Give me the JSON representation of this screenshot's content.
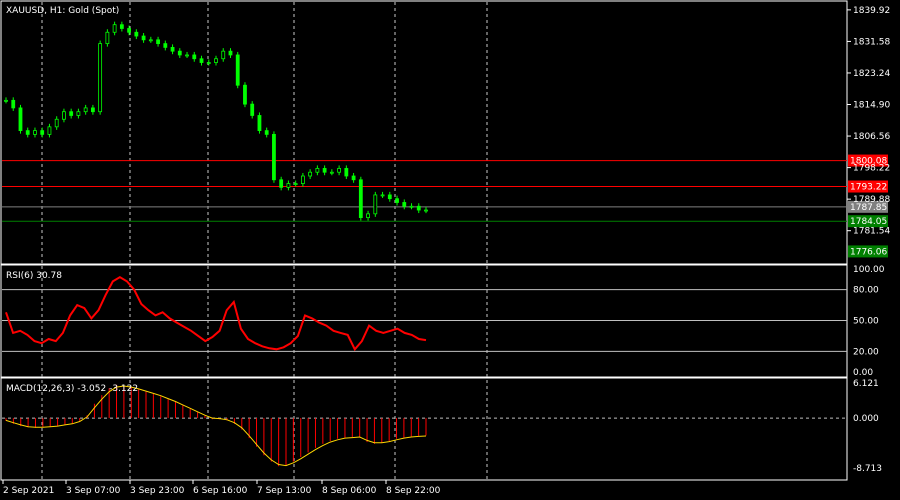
{
  "chart_title": "XAUUSD, H1:  Gold (Spot)",
  "rsi_title": "RSI(6) 30.78",
  "macd_title": "MACD(12,26,3) -3.052 -3.122",
  "price_axis": [
    "1839.92",
    "1831.58",
    "1823.24",
    "1814.90",
    "1806.56",
    "1798.22",
    "1789.88",
    "1781.54"
  ],
  "price_tags": [
    {
      "text": "1800.08",
      "kind": "red"
    },
    {
      "text": "1793.22",
      "kind": "red"
    },
    {
      "text": "1787.85",
      "kind": "grey"
    },
    {
      "text": "1784.05",
      "kind": "green"
    },
    {
      "text": "1776.06",
      "kind": "green"
    }
  ],
  "rsi_axis": [
    "100.00",
    "80.00",
    "50.00",
    "20.00",
    "0.00"
  ],
  "macd_axis": [
    "6.121",
    "0.000",
    "-8.713"
  ],
  "time_axis": [
    "2 Sep 2021",
    "3 Sep 07:00",
    "3 Sep 23:00",
    "6 Sep 16:00",
    "7 Sep 13:00",
    "8 Sep 06:00",
    "8 Sep 22:00"
  ],
  "colors": {
    "background": "#000000",
    "candle": "#00ff00",
    "grid": "#c8c8c8",
    "level_red": "#ff0000",
    "level_green": "#008000",
    "rsi": "#ff0000",
    "macd_hist": "#ff0000",
    "macd_signal": "#ffd700",
    "separator": "#ffffff"
  },
  "chart_data": {
    "type": "line",
    "title": "XAUUSD, H1:  Gold (Spot)",
    "price_levels": [
      1800.08,
      1793.22,
      1787.85,
      1784.05,
      1776.06
    ],
    "ylim": [
      1773,
      1842
    ],
    "close_series": [
      1816,
      1814,
      1808,
      1807,
      1808,
      1807,
      1809,
      1811,
      1813,
      1812,
      1813,
      1814,
      1813,
      1831,
      1834,
      1836,
      1835,
      1834,
      1833,
      1832,
      1832,
      1831,
      1830,
      1829,
      1828,
      1828,
      1827,
      1826,
      1826,
      1827,
      1829,
      1828,
      1820,
      1815,
      1812,
      1808,
      1807,
      1795,
      1793,
      1794,
      1794,
      1796,
      1797,
      1798,
      1797,
      1797,
      1798,
      1796,
      1795,
      1785,
      1786,
      1791,
      1791,
      1790,
      1789,
      1788,
      1788,
      1787,
      1787
    ],
    "rsi_series": [
      58,
      38,
      40,
      36,
      30,
      28,
      32,
      30,
      38,
      55,
      65,
      62,
      52,
      60,
      75,
      88,
      92,
      88,
      80,
      66,
      60,
      55,
      58,
      52,
      48,
      44,
      40,
      35,
      30,
      34,
      40,
      60,
      68,
      42,
      32,
      28,
      25,
      23,
      22,
      24,
      28,
      35,
      55,
      52,
      48,
      45,
      40,
      38,
      36,
      22,
      30,
      45,
      40,
      38,
      40,
      42,
      38,
      36,
      32,
      31
    ],
    "rsi_ylim": [
      0,
      100
    ],
    "macd_hist": [
      -0.5,
      -1,
      -1.4,
      -1.6,
      -1.7,
      -1.6,
      -1.5,
      -1.4,
      -1.2,
      -1,
      -0.5,
      0.5,
      2.5,
      4,
      5.2,
      5.8,
      5.6,
      5.3,
      5,
      4.6,
      4.2,
      3.8,
      3.3,
      2.8,
      2.2,
      1.6,
      1,
      0.4,
      -0.2,
      -0.2,
      -0.4,
      -1,
      -2,
      -3.5,
      -5,
      -6.5,
      -7.6,
      -8.4,
      -8.2,
      -7.6,
      -6.8,
      -6,
      -5.2,
      -4.5,
      -4,
      -3.6,
      -3.4,
      -3.3,
      -3.3,
      -4.2,
      -4.5,
      -4.3,
      -4,
      -3.6,
      -3.4,
      -3.2,
      -3.1,
      -3.05
    ],
    "macd_signal": [
      -0.4,
      -0.8,
      -1.2,
      -1.5,
      -1.6,
      -1.6,
      -1.5,
      -1.4,
      -1.2,
      -1,
      -0.6,
      0.2,
      1.8,
      3.3,
      4.6,
      5.4,
      5.6,
      5.4,
      5.1,
      4.7,
      4.3,
      3.9,
      3.4,
      2.9,
      2.3,
      1.7,
      1.1,
      0.5,
      0,
      -0.1,
      -0.3,
      -0.8,
      -1.7,
      -3.1,
      -4.6,
      -6.1,
      -7.3,
      -8.1,
      -8.3,
      -7.8,
      -7.1,
      -6.3,
      -5.5,
      -4.8,
      -4.2,
      -3.8,
      -3.5,
      -3.4,
      -3.3,
      -3.9,
      -4.3,
      -4.3,
      -4.1,
      -3.8,
      -3.5,
      -3.3,
      -3.2,
      -3.12
    ],
    "macd_ylim": [
      -8.713,
      6.121
    ]
  }
}
